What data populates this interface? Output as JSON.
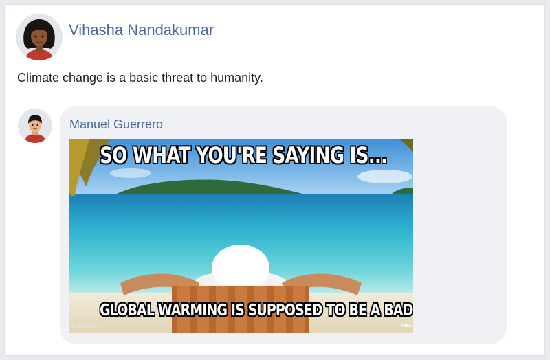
{
  "post": {
    "author_name": "Vihasha Nandakumar",
    "text": "Climate change is a basic threat to humanity."
  },
  "comment": {
    "author_name": "Manuel Guerrero",
    "meme": {
      "top_caption": "SO WHAT YOU'RE SAYING IS...",
      "bottom_caption": "GLOBAL WARMING IS SUPPOSED TO BE A BAD THING",
      "watermark": "imgflip.com",
      "watermark_right": "mea"
    }
  },
  "colors": {
    "link_blue": "#4b67a1",
    "bubble_bg": "#eff1f4",
    "page_bg": "#e9ebee"
  }
}
